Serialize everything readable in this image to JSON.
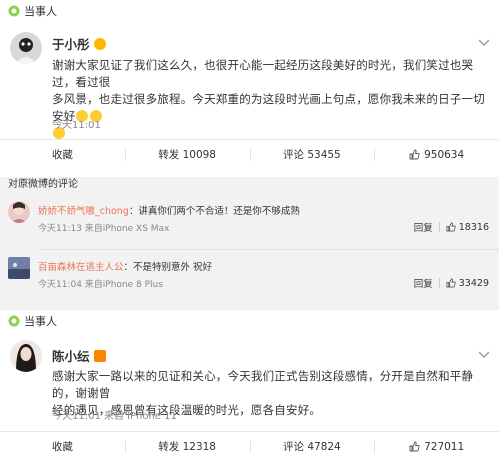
{
  "post1": {
    "tag": "当事人",
    "author": "于小彤",
    "text_line1": "谢谢大家见证了我们这么久，也很开心能一起经历这段美好的时光，我们笑过也哭过，看过很",
    "text_line2": "多风景，也走过很多旅程。今天郑重的为这段时光画上句点，愿你我未来的日子一切安好",
    "time": "今天11:01",
    "actions": {
      "fav": "收藏",
      "repost": "转发 10098",
      "comment": "评论 53455",
      "like": "950634"
    }
  },
  "comments": {
    "header": "对原微博的评论",
    "items": [
      {
        "user": "娇娇不娇气嗷_chong",
        "text": "：讲真你们两个不合适！还是你不够成熟",
        "meta": "今天11:13 来自iPhone XS Max",
        "reply": "回复",
        "likes": "18316"
      },
      {
        "user": "百亩森林在逃主人公",
        "text": "：不是特别意外 祝好",
        "meta": "今天11:04 来自iPhone 8 Plus",
        "reply": "回复",
        "likes": "33429"
      }
    ]
  },
  "post2": {
    "tag": "当事人",
    "author": "陈小纭",
    "text_line1": "感谢大家一路以来的见证和关心，今天我们正式告别这段感情，分开是自然和平静的，谢谢曾",
    "text_line2": "经的遇见，感恩曾有这段温暖的时光，愿各自安好。",
    "time": "今天11:01 来自 iPhone 11",
    "actions": {
      "fav": "收藏",
      "repost": "转发 12318",
      "comment": "评论 47824",
      "like": "727011"
    }
  },
  "colors": {
    "accent": "#eb7350",
    "vip": "#ff8200",
    "bg": "#f2f2f2"
  }
}
